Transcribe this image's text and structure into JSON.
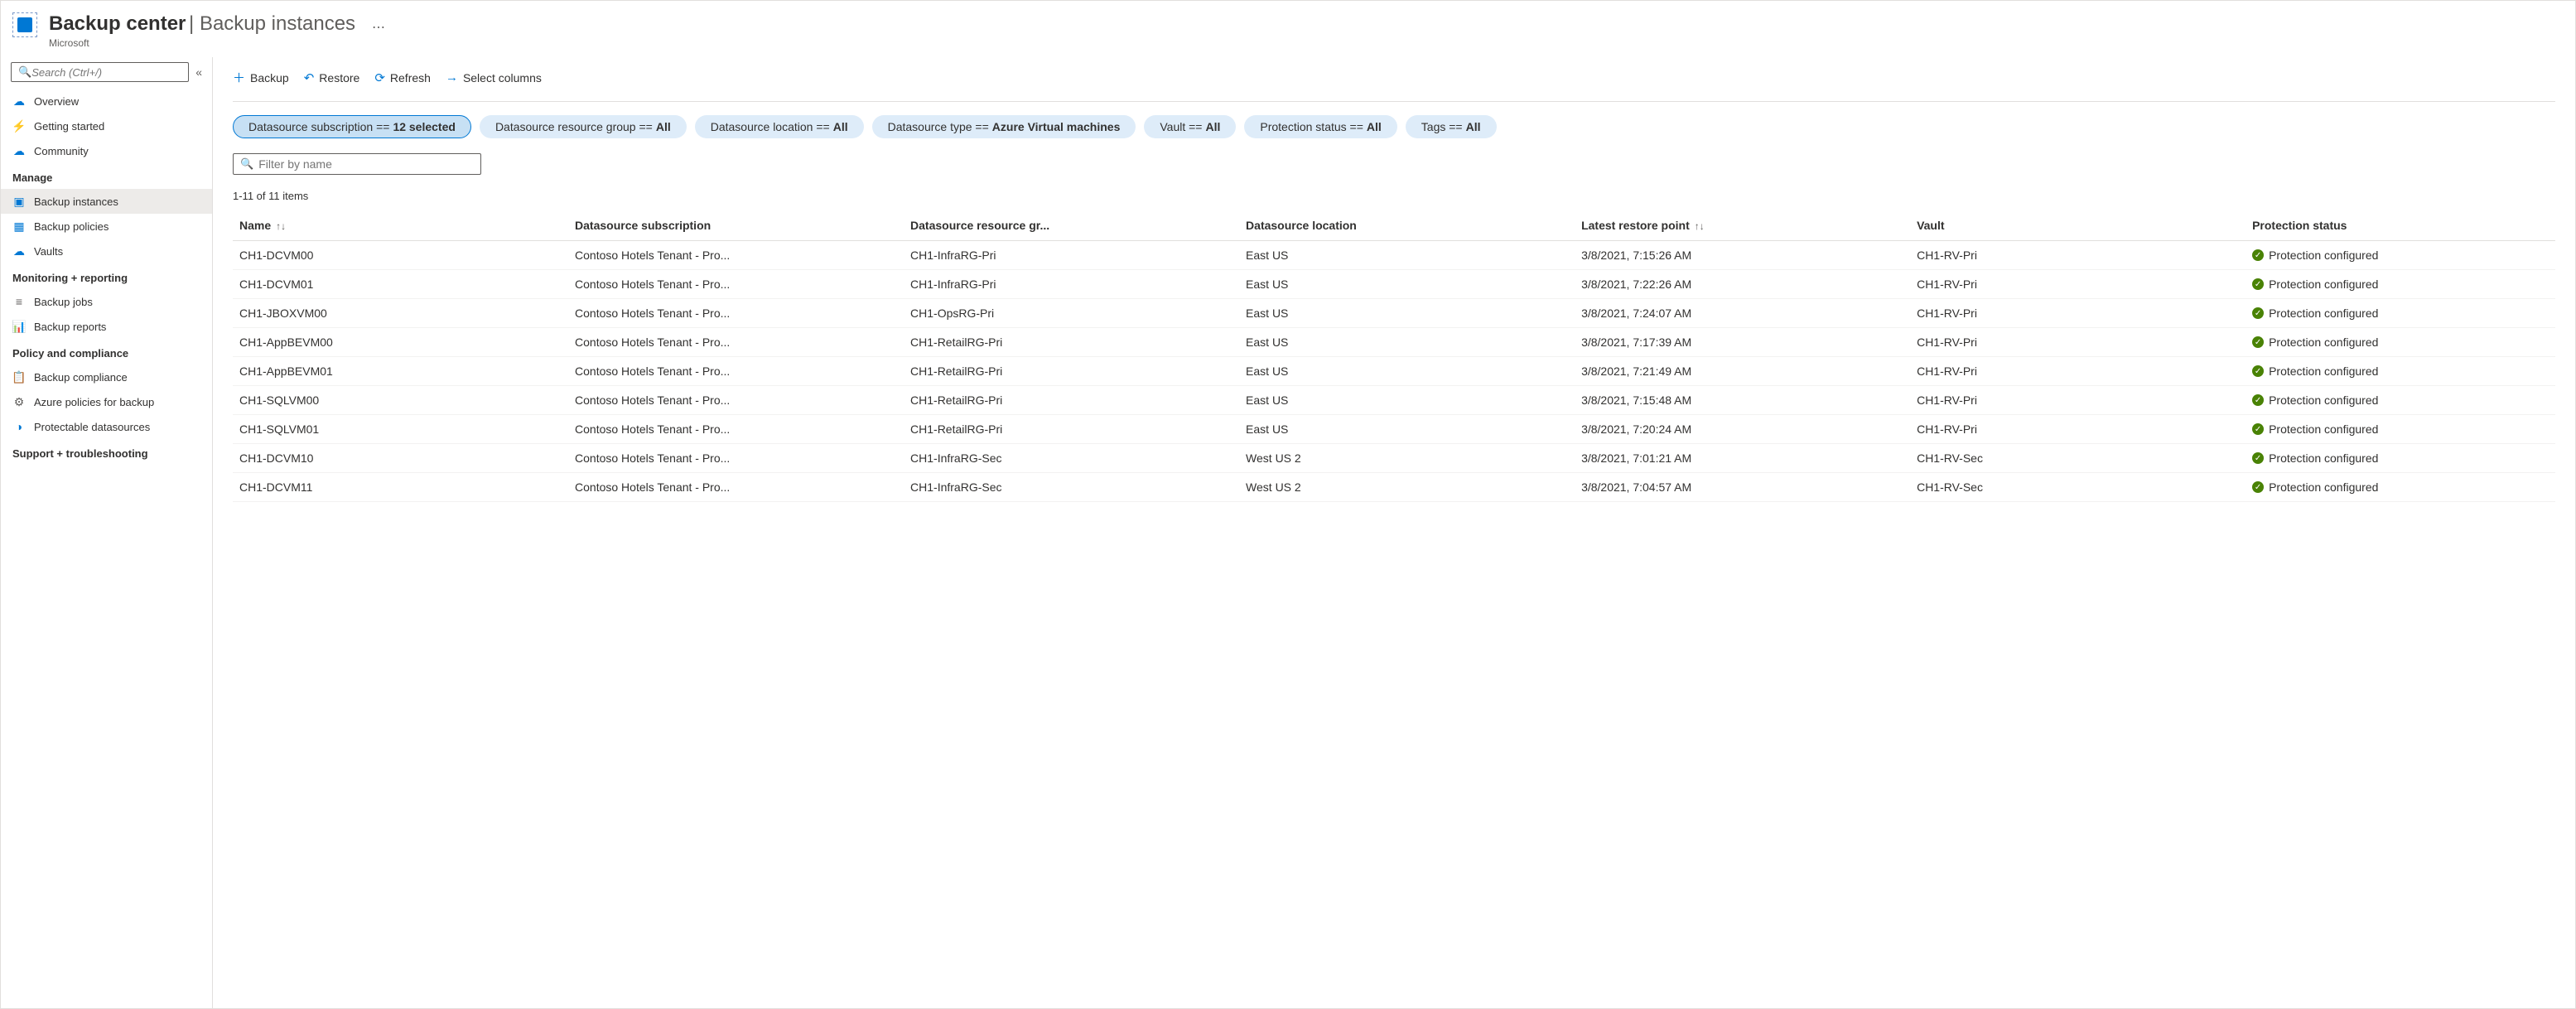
{
  "header": {
    "title": "Backup center",
    "subtitle": "Backup instances",
    "org": "Microsoft"
  },
  "sidebar": {
    "search_placeholder": "Search (Ctrl+/)",
    "items_top": [
      {
        "label": "Overview",
        "icon": "☁",
        "color": "#0078d4"
      },
      {
        "label": "Getting started",
        "icon": "⚡",
        "color": "#00a651"
      },
      {
        "label": "Community",
        "icon": "☁",
        "color": "#0078d4"
      }
    ],
    "sections": [
      {
        "heading": "Manage",
        "items": [
          {
            "label": "Backup instances",
            "icon": "▣",
            "color": "#0078d4",
            "selected": true
          },
          {
            "label": "Backup policies",
            "icon": "▦",
            "color": "#0078d4"
          },
          {
            "label": "Vaults",
            "icon": "☁",
            "color": "#0078d4"
          }
        ]
      },
      {
        "heading": "Monitoring + reporting",
        "items": [
          {
            "label": "Backup jobs",
            "icon": "≡",
            "color": "#605e5c"
          },
          {
            "label": "Backup reports",
            "icon": "📊",
            "color": "#d13438"
          }
        ]
      },
      {
        "heading": "Policy and compliance",
        "items": [
          {
            "label": "Backup compliance",
            "icon": "📋",
            "color": "#0078d4"
          },
          {
            "label": "Azure policies for backup",
            "icon": "⚙",
            "color": "#605e5c"
          },
          {
            "label": "Protectable datasources",
            "icon": "◑",
            "color": "#0078d4"
          }
        ]
      },
      {
        "heading": "Support + troubleshooting",
        "items": []
      }
    ]
  },
  "toolbar": {
    "backup": "Backup",
    "restore": "Restore",
    "refresh": "Refresh",
    "select_columns": "Select columns"
  },
  "filters": [
    {
      "label": "Datasource subscription == ",
      "value": "12 selected",
      "active": true
    },
    {
      "label": "Datasource resource group == ",
      "value": "All"
    },
    {
      "label": "Datasource location == ",
      "value": "All"
    },
    {
      "label": "Datasource type == ",
      "value": "Azure Virtual machines"
    },
    {
      "label": "Vault == ",
      "value": "All"
    },
    {
      "label": "Protection status == ",
      "value": "All"
    },
    {
      "label": "Tags == ",
      "value": "All"
    }
  ],
  "filter_input_placeholder": "Filter by name",
  "count_text": "1-11 of 11 items",
  "columns": {
    "name": "Name",
    "subscription": "Datasource subscription",
    "resource_group": "Datasource resource gr...",
    "location": "Datasource location",
    "restore_point": "Latest restore point",
    "vault": "Vault",
    "status": "Protection status"
  },
  "rows": [
    {
      "name": "CH1-DCVM00",
      "subscription": "Contoso Hotels Tenant - Pro...",
      "rg": "CH1-InfraRG-Pri",
      "location": "East US",
      "rp": "3/8/2021, 7:15:26 AM",
      "vault": "CH1-RV-Pri",
      "status": "Protection configured"
    },
    {
      "name": "CH1-DCVM01",
      "subscription": "Contoso Hotels Tenant - Pro...",
      "rg": "CH1-InfraRG-Pri",
      "location": "East US",
      "rp": "3/8/2021, 7:22:26 AM",
      "vault": "CH1-RV-Pri",
      "status": "Protection configured"
    },
    {
      "name": "CH1-JBOXVM00",
      "subscription": "Contoso Hotels Tenant - Pro...",
      "rg": "CH1-OpsRG-Pri",
      "location": "East US",
      "rp": "3/8/2021, 7:24:07 AM",
      "vault": "CH1-RV-Pri",
      "status": "Protection configured"
    },
    {
      "name": "CH1-AppBEVM00",
      "subscription": "Contoso Hotels Tenant - Pro...",
      "rg": "CH1-RetailRG-Pri",
      "location": "East US",
      "rp": "3/8/2021, 7:17:39 AM",
      "vault": "CH1-RV-Pri",
      "status": "Protection configured"
    },
    {
      "name": "CH1-AppBEVM01",
      "subscription": "Contoso Hotels Tenant - Pro...",
      "rg": "CH1-RetailRG-Pri",
      "location": "East US",
      "rp": "3/8/2021, 7:21:49 AM",
      "vault": "CH1-RV-Pri",
      "status": "Protection configured"
    },
    {
      "name": "CH1-SQLVM00",
      "subscription": "Contoso Hotels Tenant - Pro...",
      "rg": "CH1-RetailRG-Pri",
      "location": "East US",
      "rp": "3/8/2021, 7:15:48 AM",
      "vault": "CH1-RV-Pri",
      "status": "Protection configured"
    },
    {
      "name": "CH1-SQLVM01",
      "subscription": "Contoso Hotels Tenant - Pro...",
      "rg": "CH1-RetailRG-Pri",
      "location": "East US",
      "rp": "3/8/2021, 7:20:24 AM",
      "vault": "CH1-RV-Pri",
      "status": "Protection configured"
    },
    {
      "name": "CH1-DCVM10",
      "subscription": "Contoso Hotels Tenant - Pro...",
      "rg": "CH1-InfraRG-Sec",
      "location": "West US 2",
      "rp": "3/8/2021, 7:01:21 AM",
      "vault": "CH1-RV-Sec",
      "status": "Protection configured"
    },
    {
      "name": "CH1-DCVM11",
      "subscription": "Contoso Hotels Tenant - Pro...",
      "rg": "CH1-InfraRG-Sec",
      "location": "West US 2",
      "rp": "3/8/2021, 7:04:57 AM",
      "vault": "CH1-RV-Sec",
      "status": "Protection configured"
    }
  ]
}
